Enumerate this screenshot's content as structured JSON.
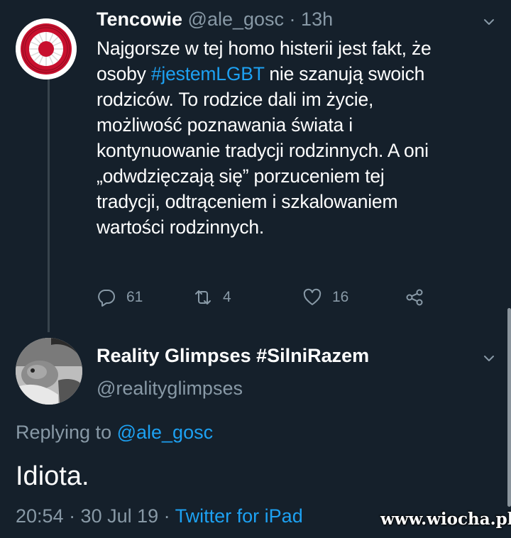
{
  "tweet1": {
    "display_name": "Tencowie",
    "handle": "@ale_gosc",
    "separator": " · ",
    "time": "13h",
    "text_lines": [
      {
        "before": "Najgorsze w tej homo histerii jest fakt, że",
        "hashtag": "",
        "after": ""
      },
      {
        "before": "osoby ",
        "hashtag": "#jestemLGBT",
        "after": " nie szanują swoich"
      },
      {
        "before": "rodziców. To rodzice dali im życie,",
        "hashtag": "",
        "after": ""
      },
      {
        "before": "możliwość poznawania świata i",
        "hashtag": "",
        "after": ""
      },
      {
        "before": "kontynuowanie tradycji rodzinnych. A oni",
        "hashtag": "",
        "after": ""
      },
      {
        "before": "„odwdzięczają się” porzuceniem tej",
        "hashtag": "",
        "after": ""
      },
      {
        "before": "tradycji, odtrąceniem i szkalowaniem",
        "hashtag": "",
        "after": ""
      },
      {
        "before": "wartości rodzinnych.",
        "hashtag": "",
        "after": ""
      }
    ],
    "actions": {
      "reply_count": "61",
      "retweet_count": "4",
      "like_count": "16"
    }
  },
  "tweet2": {
    "display_name": "Reality Glimpses #SilniRazem",
    "handle": "@realityglimpses",
    "replying_prefix": "Replying to ",
    "replying_to": "@ale_gosc",
    "text": "Idiota.",
    "timestamp": "20:54 · 30 Jul 19 · ",
    "source": "Twitter for iPad"
  },
  "watermark": "www.wiocha.pl",
  "icons": {
    "reply": "reply-icon",
    "retweet": "retweet-icon",
    "like": "heart-icon",
    "share": "share-icon",
    "more": "chevron-down-icon"
  },
  "colors": {
    "background": "#15202b",
    "secondary_text": "#8899a6",
    "link": "#1da1f2",
    "divider": "#38444d"
  }
}
